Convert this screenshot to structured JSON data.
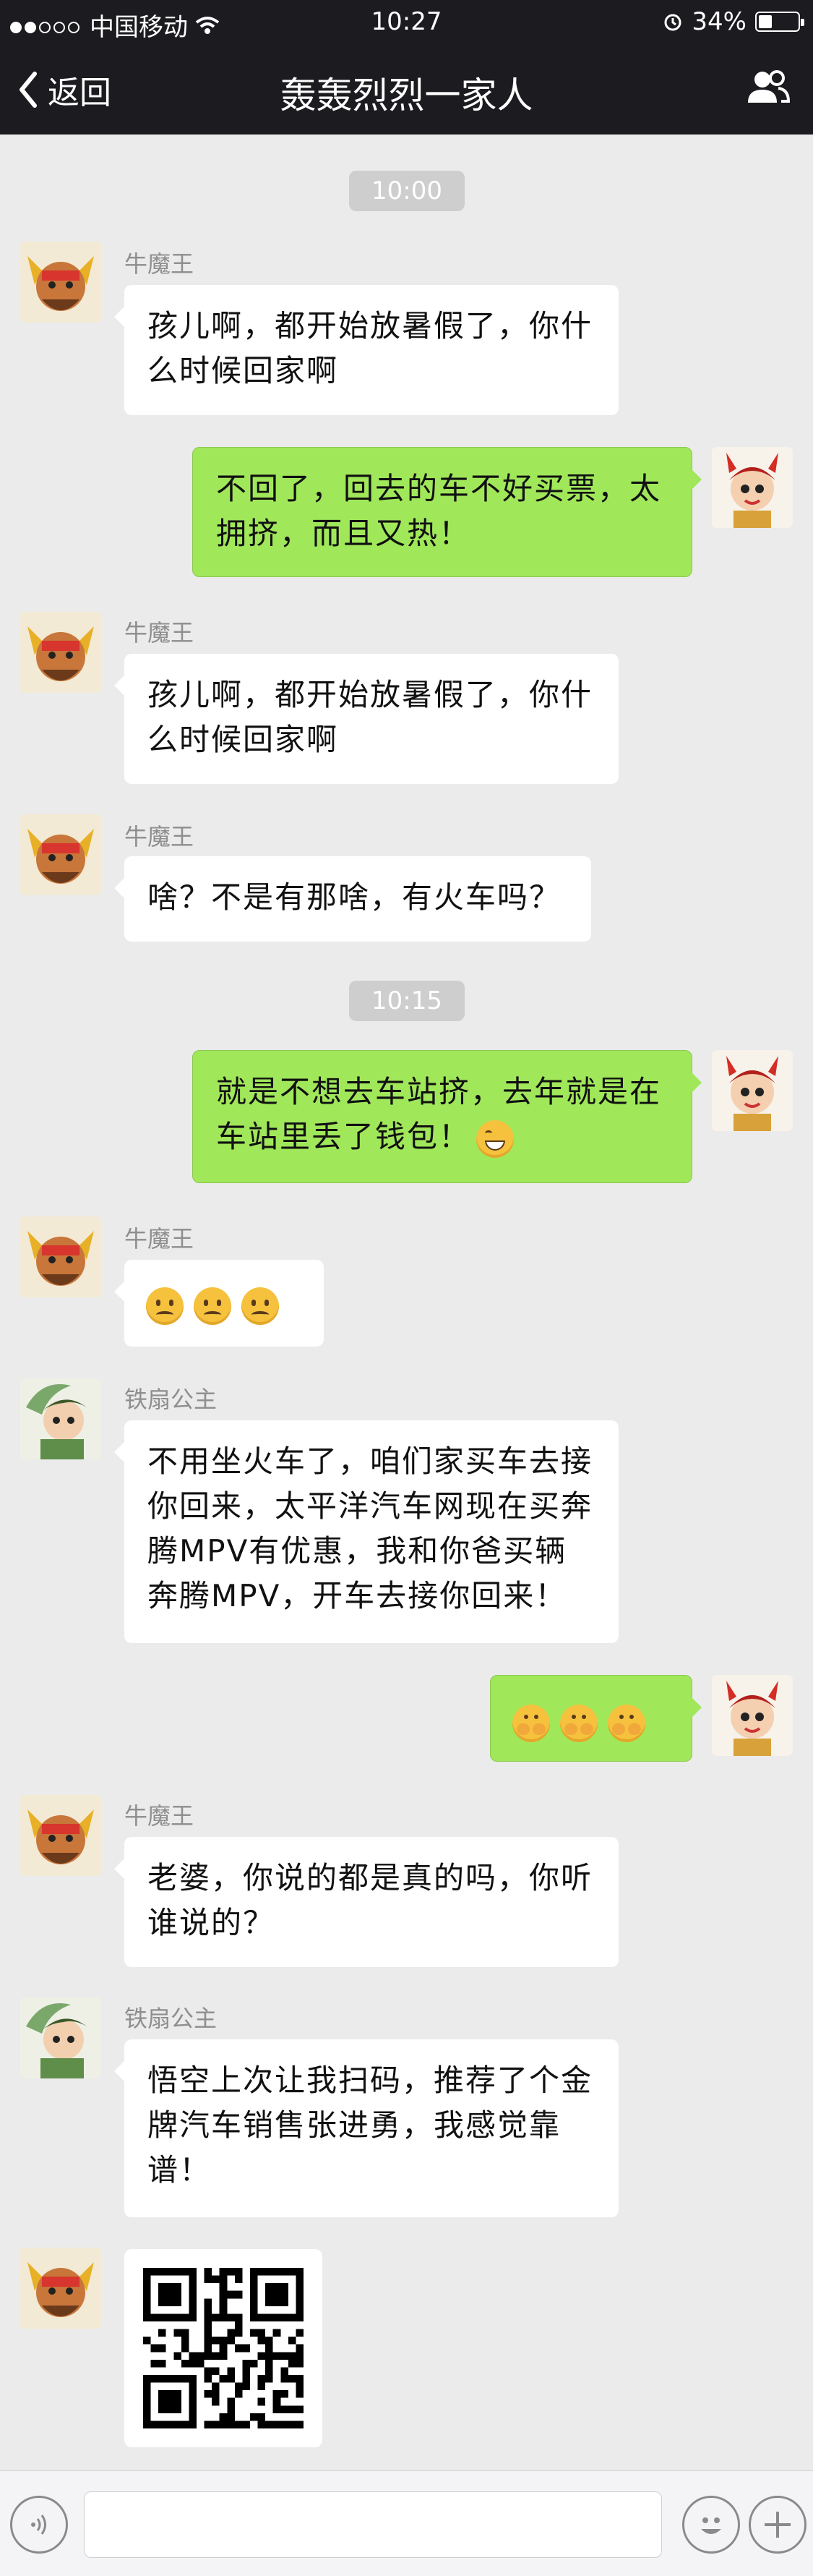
{
  "status": {
    "carrier": "中国移动",
    "time": "10:27",
    "battery": "34%",
    "battery_level": 0.34,
    "signal_dots_filled": 2
  },
  "nav": {
    "back_label": "返回",
    "title": "轰轰烈烈一家人"
  },
  "messages": {
    "t1": "10:00",
    "m1_sender": "牛魔王",
    "m1_text": "孩儿啊，都开始放暑假了，你什么时候回家啊",
    "m2_text": "不回了，回去的车不好买票，太拥挤，而且又热！",
    "m3_sender": "牛魔王",
    "m3_text": "孩儿啊，都开始放暑假了，你什么时候回家啊",
    "m4_sender": "牛魔王",
    "m4_text": "啥？不是有那啥，有火车吗？",
    "t2": "10:15",
    "m5_text": "就是不想去车站挤，去年就是在车站里丢了钱包！",
    "m6_sender": "牛魔王",
    "m7_sender": "铁扇公主",
    "m7_text": "不用坐火车了，咱们家买车去接你回来，太平洋汽车网现在买奔腾MPV有优惠，我和你爸买辆奔腾MPV，开车去接你回来！",
    "m9_sender": "牛魔王",
    "m9_text": "老婆，你说的都是真的吗，你听谁说的？",
    "m10_sender": "铁扇公主",
    "m10_text": "悟空上次让我扫码，推荐了个金牌汽车销售张进勇，我感觉靠谱！"
  },
  "icons": [
    "wifi-icon",
    "alarm-icon",
    "battery-icon",
    "back-chevron-icon",
    "group-members-icon",
    "voice-icon",
    "emoji-icon",
    "plus-icon",
    "qr-code-image"
  ]
}
